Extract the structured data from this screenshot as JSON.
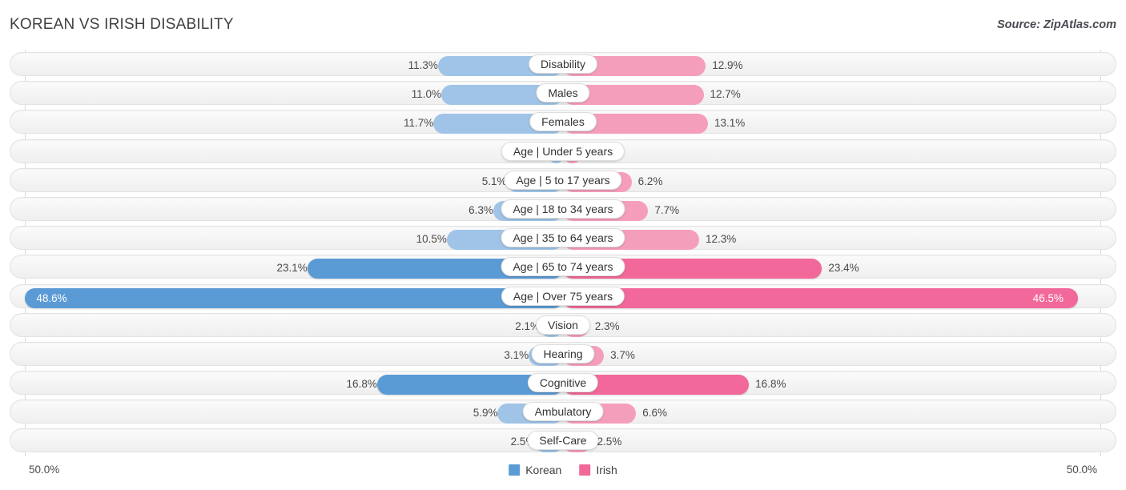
{
  "header": {
    "title": "KOREAN VS IRISH DISABILITY",
    "source": "Source: ZipAtlas.com"
  },
  "axis": {
    "left_label": "50.0%",
    "right_label": "50.0%",
    "max": 50.0
  },
  "legend": {
    "items": [
      {
        "label": "Korean",
        "color": "#5b9bd5"
      },
      {
        "label": "Irish",
        "color": "#f2689a"
      }
    ]
  },
  "colors": {
    "korean_light": "#9fc4e7",
    "korean_dark": "#5b9bd5",
    "irish_light": "#f59ebc",
    "irish_dark": "#f2689a",
    "track": "#f4f4f4",
    "gridline": "#d8d8d8",
    "text": "#4a4a4a"
  },
  "chart_data": {
    "type": "bar",
    "title": "KOREAN VS IRISH DISABILITY",
    "subtitle": "Source: ZipAtlas.com",
    "orientation": "horizontal-diverging",
    "xlabel": "",
    "ylabel": "",
    "xlim": [
      0,
      50.0
    ],
    "grid": true,
    "legend_position": "bottom-center",
    "categories": [
      "Disability",
      "Males",
      "Females",
      "Age | Under 5 years",
      "Age | 5 to 17 years",
      "Age | 18 to 34 years",
      "Age | 35 to 64 years",
      "Age | 65 to 74 years",
      "Age | Over 75 years",
      "Vision",
      "Hearing",
      "Cognitive",
      "Ambulatory",
      "Self-Care"
    ],
    "series": [
      {
        "name": "Korean",
        "color": "#9fc4e7",
        "values": [
          11.3,
          11.0,
          11.7,
          1.2,
          5.1,
          6.3,
          10.5,
          23.1,
          48.6,
          2.1,
          3.1,
          16.8,
          5.9,
          2.5
        ]
      },
      {
        "name": "Irish",
        "color": "#f59ebc",
        "values": [
          12.9,
          12.7,
          13.1,
          1.7,
          6.2,
          7.7,
          12.3,
          23.4,
          46.5,
          2.3,
          3.7,
          16.8,
          6.6,
          2.5
        ]
      }
    ]
  },
  "rows": [
    {
      "label": "Disability",
      "left": "11.3%",
      "right": "12.9%",
      "lv": 11.3,
      "rv": 12.9,
      "emph": false
    },
    {
      "label": "Males",
      "left": "11.0%",
      "right": "12.7%",
      "lv": 11.0,
      "rv": 12.7,
      "emph": false
    },
    {
      "label": "Females",
      "left": "11.7%",
      "right": "13.1%",
      "lv": 11.7,
      "rv": 13.1,
      "emph": false
    },
    {
      "label": "Age | Under 5 years",
      "left": "1.2%",
      "right": "1.7%",
      "lv": 1.2,
      "rv": 1.7,
      "emph": false
    },
    {
      "label": "Age | 5 to 17 years",
      "left": "5.1%",
      "right": "6.2%",
      "lv": 5.1,
      "rv": 6.2,
      "emph": false
    },
    {
      "label": "Age | 18 to 34 years",
      "left": "6.3%",
      "right": "7.7%",
      "lv": 6.3,
      "rv": 7.7,
      "emph": false
    },
    {
      "label": "Age | 35 to 64 years",
      "left": "10.5%",
      "right": "12.3%",
      "lv": 10.5,
      "rv": 12.3,
      "emph": false
    },
    {
      "label": "Age | 65 to 74 years",
      "left": "23.1%",
      "right": "23.4%",
      "lv": 23.1,
      "rv": 23.4,
      "emph": true
    },
    {
      "label": "Age | Over 75 years",
      "left": "48.6%",
      "right": "46.5%",
      "lv": 48.6,
      "rv": 46.5,
      "emph": true,
      "inside": true
    },
    {
      "label": "Vision",
      "left": "2.1%",
      "right": "2.3%",
      "lv": 2.1,
      "rv": 2.3,
      "emph": false
    },
    {
      "label": "Hearing",
      "left": "3.1%",
      "right": "3.7%",
      "lv": 3.1,
      "rv": 3.7,
      "emph": false
    },
    {
      "label": "Cognitive",
      "left": "16.8%",
      "right": "16.8%",
      "lv": 16.8,
      "rv": 16.8,
      "emph": true
    },
    {
      "label": "Ambulatory",
      "left": "5.9%",
      "right": "6.6%",
      "lv": 5.9,
      "rv": 6.6,
      "emph": false
    },
    {
      "label": "Self-Care",
      "left": "2.5%",
      "right": "2.5%",
      "lv": 2.5,
      "rv": 2.5,
      "emph": false
    }
  ]
}
